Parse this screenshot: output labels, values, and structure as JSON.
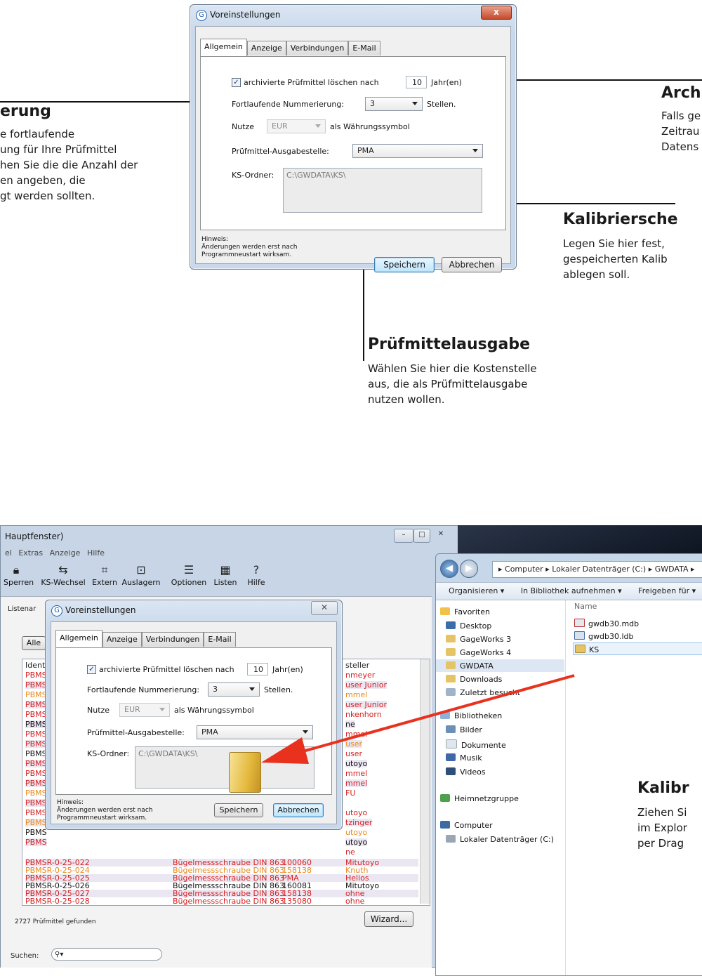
{
  "callouts": {
    "left": {
      "title": "erung",
      "lines": [
        "e fortlaufende",
        "ung für Ihre Prüfmittel",
        "hen Sie die die Anzahl der",
        "en angeben, die",
        "gt werden sollten."
      ]
    },
    "right_top": {
      "title": "Arch",
      "lines": [
        "Falls ge",
        "Zeitrau",
        "Datens"
      ]
    },
    "right_mid": {
      "title": "Kalibriersche",
      "lines": [
        "Legen Sie hier fest,",
        "gespeicherten Kalib",
        "ablegen soll."
      ]
    },
    "bottom": {
      "title": "Prüfmittelausgabe",
      "lines": [
        "Wählen Sie hier die Kostenstelle",
        "aus, die als Prüfmittelausgabe",
        "nutzen wollen."
      ]
    },
    "explorer": {
      "title": "Kalibr",
      "lines": [
        "Ziehen Si",
        "im Explor",
        "per Drag"
      ]
    }
  },
  "dialog": {
    "title": "Voreinstellungen",
    "close_label": "x",
    "tabs": [
      "Allgemein",
      "Anzeige",
      "Verbindungen",
      "E-Mail"
    ],
    "archive_checkbox_label": "archivierte Prüfmittel löschen nach",
    "archive_checked": true,
    "archive_value": "10",
    "archive_unit": "Jahr(en)",
    "numbering_label": "Fortlaufende Nummerierung:",
    "numbering_value": "3",
    "numbering_unit": "Stellen.",
    "currency_prefix": "Nutze",
    "currency_value": "EUR",
    "currency_suffix": "als Währungssymbol",
    "issue_label": "Prüfmittel-Ausgabestelle:",
    "issue_value": "PMA",
    "folder_label": "KS-Ordner:",
    "folder_value": "C:\\GWDATA\\KS\\",
    "hint_lines": [
      "Hinweis:",
      "Änderungen werden erst nach",
      "Programmneustart wirksam."
    ],
    "save_label": "Speichern",
    "cancel_label": "Abbrechen"
  },
  "app": {
    "title": "Hauptfenster)",
    "menu": [
      "el",
      "Extras",
      "Anzeige",
      "Hilfe"
    ],
    "toolbar": [
      "Sperren",
      "KS-Wechsel",
      "Extern",
      "Auslagern",
      "Optionen",
      "Listen",
      "Hilfe"
    ],
    "list_tab": "Listenar",
    "filter_button": "Alle",
    "col_ident": "Ident",
    "col_owner": "steller",
    "status": "2727 Prüfmittel gefunden",
    "wizard_label": "Wizard...",
    "search_label": "Suchen:",
    "left_rows": [
      {
        "t": "PBMS",
        "c": "#d62020"
      },
      {
        "t": "PBMS",
        "c": "#d62020"
      },
      {
        "t": "PBMS",
        "c": "#e88a1a"
      },
      {
        "t": "PBMS",
        "c": "#d62020"
      },
      {
        "t": "PBMS",
        "c": "#d62020"
      },
      {
        "t": "PBMS",
        "c": "#111111"
      },
      {
        "t": "PBMS",
        "c": "#d62020"
      },
      {
        "t": "PBMS",
        "c": "#d62020"
      },
      {
        "t": "PBMS",
        "c": "#111111"
      },
      {
        "t": "PBMS",
        "c": "#d62020"
      },
      {
        "t": "PBMS",
        "c": "#d62020"
      },
      {
        "t": "PBMS",
        "c": "#d62020"
      },
      {
        "t": "PBMS",
        "c": "#e88a1a"
      },
      {
        "t": "PBMS",
        "c": "#d62020"
      },
      {
        "t": "PBMS",
        "c": "#d62020"
      },
      {
        "t": "PBMS",
        "c": "#e88a1a"
      },
      {
        "t": "PBMS",
        "c": "#111111"
      },
      {
        "t": "PBMS",
        "c": "#d62020"
      }
    ],
    "right_rows": [
      {
        "t": "nmeyer",
        "c": "#d62020"
      },
      {
        "t": "user Junior",
        "c": "#d62020"
      },
      {
        "t": "mmel",
        "c": "#e88a1a"
      },
      {
        "t": "user Junior",
        "c": "#d62020"
      },
      {
        "t": "nkenhorn",
        "c": "#d62020"
      },
      {
        "t": "ne",
        "c": "#111111"
      },
      {
        "t": "mmel",
        "c": "#d62020"
      },
      {
        "t": "user",
        "c": "#e88a1a"
      },
      {
        "t": "user",
        "c": "#d62020"
      },
      {
        "t": "utoyo",
        "c": "#111111"
      },
      {
        "t": "mmel",
        "c": "#d62020"
      },
      {
        "t": "mmel",
        "c": "#d62020"
      },
      {
        "t": "FU",
        "c": "#d62020"
      },
      {
        "t": "",
        "c": "#111111"
      },
      {
        "t": "utoyo",
        "c": "#d62020"
      },
      {
        "t": "tzinger",
        "c": "#d62020"
      },
      {
        "t": "utoyo",
        "c": "#e88a1a"
      },
      {
        "t": "utoyo",
        "c": "#111111"
      },
      {
        "t": "ne",
        "c": "#d62020"
      }
    ],
    "bottom_rows": [
      {
        "id": "PBMSR-0-25-022",
        "desc": "Bügelmessschraube DIN 863",
        "loc": "100060",
        "own": "Mitutoyo",
        "c": "#d62020"
      },
      {
        "id": "PBMSR-0-25-024",
        "desc": "Bügelmessschraube DIN 863",
        "loc": "158138",
        "own": "Knuth",
        "c": "#e88a1a"
      },
      {
        "id": "PBMSR-0-25-025",
        "desc": "Bügelmessschraube DIN 863",
        "loc": "PMA",
        "own": "Helios",
        "c": "#d62020"
      },
      {
        "id": "PBMSR-0-25-026",
        "desc": "Bügelmessschraube DIN 863",
        "loc": "160081",
        "own": "Mitutoyo",
        "c": "#111111"
      },
      {
        "id": "PBMSR-0-25-027",
        "desc": "Bügelmessschraube DIN 863",
        "loc": "158138",
        "own": "ohne",
        "c": "#d62020"
      },
      {
        "id": "PBMSR-0-25-028",
        "desc": "Bügelmessschraube DIN 863",
        "loc": "135080",
        "own": "ohne",
        "c": "#d62020"
      }
    ]
  },
  "explorer": {
    "breadcrumb": "▸ Computer ▸ Lokaler Datenträger (C:) ▸ GWDATA ▸",
    "commands": [
      "Organisieren ▾",
      "In Bibliothek aufnehmen ▾",
      "Freigeben für ▾"
    ],
    "name_header": "Name",
    "nav": [
      "Favoriten",
      "Desktop",
      "GageWorks 3",
      "GageWorks 4",
      "GWDATA",
      "Downloads",
      "Zuletzt besucht",
      "Bibliotheken",
      "Bilder",
      "Dokumente",
      "Musik",
      "Videos",
      "Heimnetzgruppe",
      "Computer",
      "Lokaler Datenträger (C:)"
    ],
    "files": [
      "gwdb30.mdb",
      "gwdb30.ldb",
      "KS"
    ]
  },
  "colors": {
    "arrow": "#e8321e",
    "accent": "#3c7fb1",
    "warning": "#d62020",
    "orange": "#e88a1a"
  }
}
